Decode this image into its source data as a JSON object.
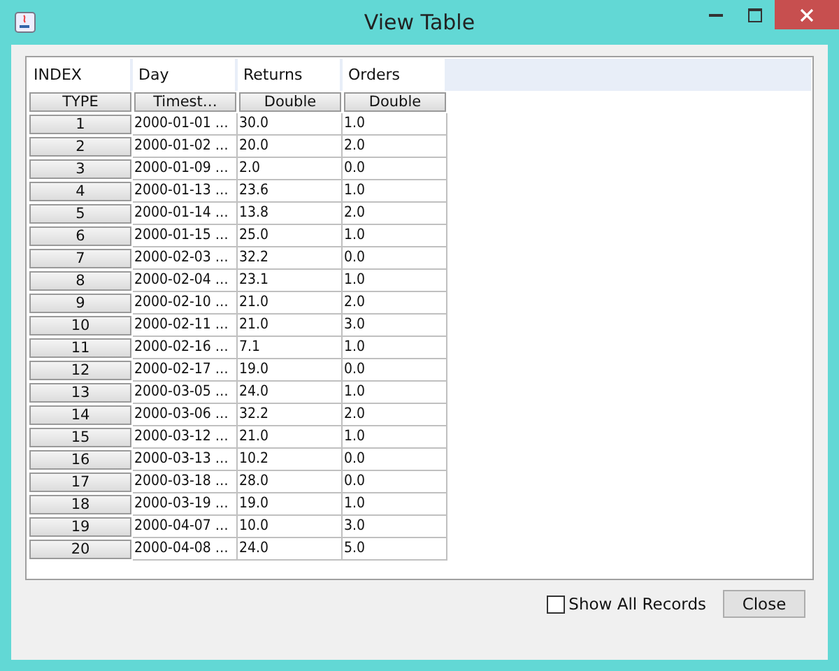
{
  "window": {
    "title": "View Table"
  },
  "table": {
    "columns": [
      "INDEX",
      "Day",
      "Returns",
      "Orders"
    ],
    "types": [
      "TYPE",
      "Timest…",
      "Double",
      "Double"
    ],
    "rows": [
      [
        "1",
        "2000-01-01 …",
        "30.0",
        "1.0"
      ],
      [
        "2",
        "2000-01-02 …",
        "20.0",
        "2.0"
      ],
      [
        "3",
        "2000-01-09 …",
        "2.0",
        "0.0"
      ],
      [
        "4",
        "2000-01-13 …",
        "23.6",
        "1.0"
      ],
      [
        "5",
        "2000-01-14 …",
        "13.8",
        "2.0"
      ],
      [
        "6",
        "2000-01-15 …",
        "25.0",
        "1.0"
      ],
      [
        "7",
        "2000-02-03 …",
        "32.2",
        "0.0"
      ],
      [
        "8",
        "2000-02-04 …",
        "23.1",
        "1.0"
      ],
      [
        "9",
        "2000-02-10 …",
        "21.0",
        "2.0"
      ],
      [
        "10",
        "2000-02-11 …",
        "21.0",
        "3.0"
      ],
      [
        "11",
        "2000-02-16 …",
        "7.1",
        "1.0"
      ],
      [
        "12",
        "2000-02-17 …",
        "19.0",
        "0.0"
      ],
      [
        "13",
        "2000-03-05 …",
        "24.0",
        "1.0"
      ],
      [
        "14",
        "2000-03-06 …",
        "32.2",
        "2.0"
      ],
      [
        "15",
        "2000-03-12 …",
        "21.0",
        "1.0"
      ],
      [
        "16",
        "2000-03-13 …",
        "10.2",
        "0.0"
      ],
      [
        "17",
        "2000-03-18 …",
        "28.0",
        "0.0"
      ],
      [
        "18",
        "2000-03-19 …",
        "19.0",
        "1.0"
      ],
      [
        "19",
        "2000-04-07 …",
        "10.0",
        "3.0"
      ],
      [
        "20",
        "2000-04-08 …",
        "24.0",
        "5.0"
      ]
    ]
  },
  "show_all_records": {
    "label": "Show All Records",
    "checked": false
  },
  "buttons": [
    "Close"
  ]
}
